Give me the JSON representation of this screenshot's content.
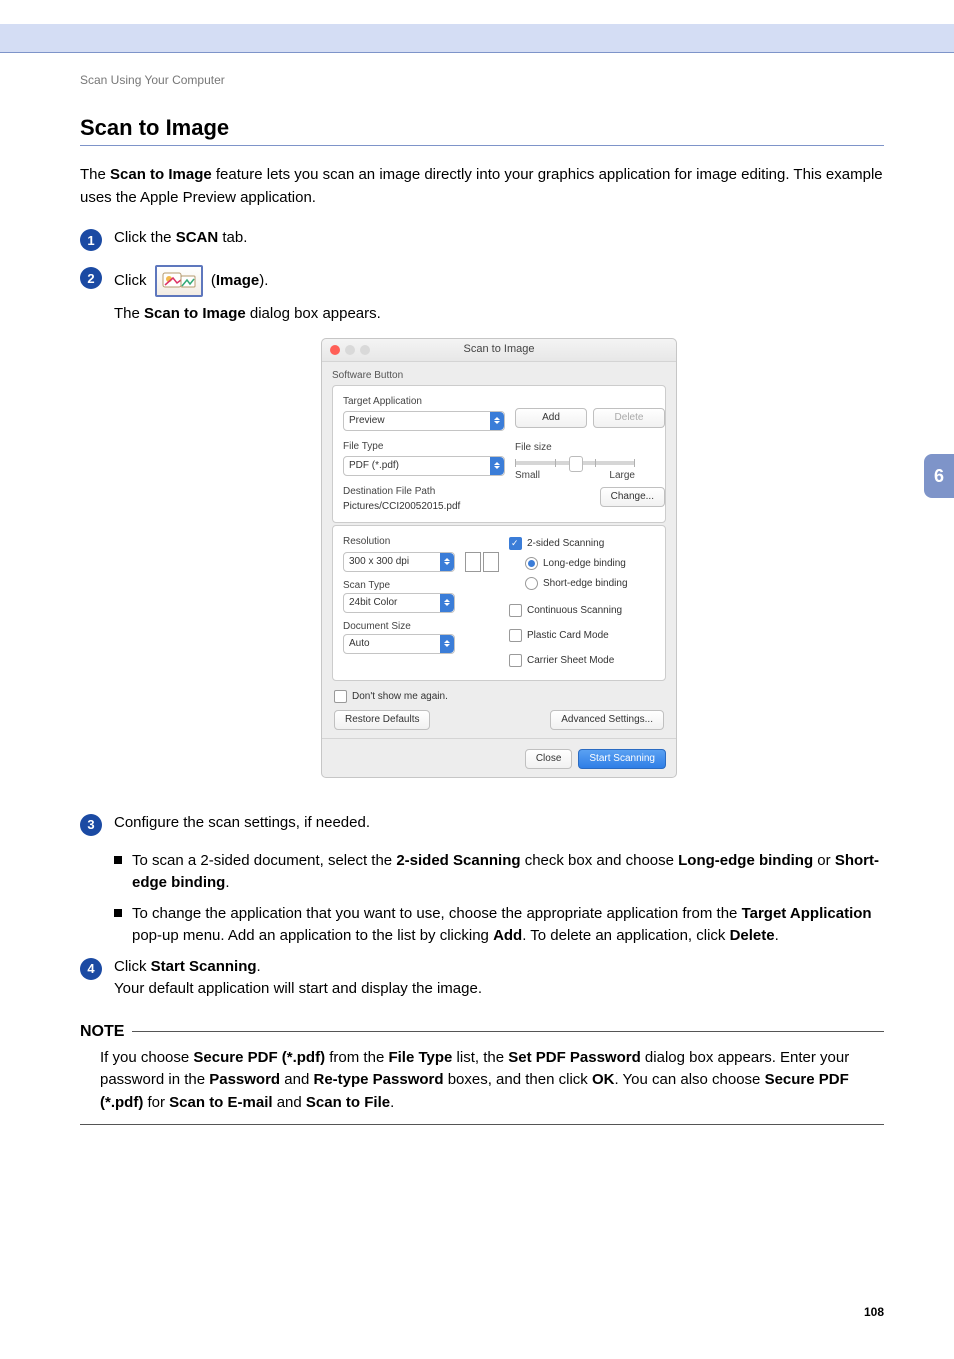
{
  "page": {
    "breadcrumb": "Scan Using Your Computer",
    "heading": "Scan to Image",
    "side_tab": "6",
    "page_number": "108"
  },
  "intro": "The Scan to Image feature lets you scan an image directly into your graphics application for image editing. This example uses the Apple Preview application.",
  "steps": {
    "s1": {
      "num": "1",
      "pre": "Click the ",
      "bold": "SCAN",
      "post": " tab."
    },
    "s2": {
      "num": "2",
      "pre": "Click ",
      "post_label": " (",
      "bold": "Image",
      "post_close": ").",
      "line2_pre": "The ",
      "line2_bold": "Scan to Image",
      "line2_post": " dialog box appears."
    },
    "s3": {
      "num": "3",
      "text": "Configure the scan settings, if needed.",
      "b1": {
        "pre": "To scan a 2-sided document, select the ",
        "b1": "2-sided Scanning",
        "mid": " check box and choose ",
        "b2": "Long-edge binding",
        "or": " or ",
        "b3": "Short-edge binding",
        "end": "."
      },
      "b2": {
        "pre": "To change the application that you want to use, choose the appropriate application from the ",
        "b1": "Target Application",
        "mid": " pop-up menu. Add an application to the list by clicking ",
        "b2": "Add",
        "mid2": ". To delete an application, click ",
        "b3": "Delete",
        "end": "."
      }
    },
    "s4": {
      "num": "4",
      "pre": "Click ",
      "bold": "Start Scanning",
      "post": ".",
      "line2": "Your default application will start and display the image."
    }
  },
  "note": {
    "title": "NOTE",
    "t1": "If you choose ",
    "b1": "Secure PDF (*.pdf)",
    "t2": " from the ",
    "b2": "File Type",
    "t3": " list, the ",
    "b3": "Set PDF Password",
    "t4": " dialog box appears. Enter your password in the ",
    "b4": "Password",
    "t5": " and ",
    "b5": "Re-type Password",
    "t6": " boxes, and then click ",
    "b6": "OK",
    "t7": ". You can also choose ",
    "b7": "Secure PDF (*.pdf)",
    "t8": " for ",
    "b8": "Scan to E-mail",
    "t9": " and ",
    "b9": "Scan to File",
    "t10": "."
  },
  "dialog": {
    "title": "Scan to Image",
    "software_button": "Software Button",
    "target_app_label": "Target Application",
    "target_app_value": "Preview",
    "add_btn": "Add",
    "delete_btn": "Delete",
    "file_type_label": "File Type",
    "file_type_value": "PDF (*.pdf)",
    "file_size_label": "File size",
    "file_size_small": "Small",
    "file_size_large": "Large",
    "dest_path_label": "Destination File Path",
    "dest_path_value": "Pictures/CCI20052015.pdf",
    "change_btn": "Change...",
    "resolution_label": "Resolution",
    "resolution_value": "300 x 300 dpi",
    "scan_type_label": "Scan Type",
    "scan_type_value": "24bit Color",
    "doc_size_label": "Document Size",
    "doc_size_value": "Auto",
    "two_sided": "2-sided Scanning",
    "long_edge": "Long-edge binding",
    "short_edge": "Short-edge binding",
    "continuous": "Continuous Scanning",
    "plastic": "Plastic Card Mode",
    "carrier": "Carrier Sheet Mode",
    "dont_show": "Don't show me again.",
    "restore": "Restore Defaults",
    "advanced": "Advanced Settings...",
    "close": "Close",
    "start": "Start Scanning"
  }
}
